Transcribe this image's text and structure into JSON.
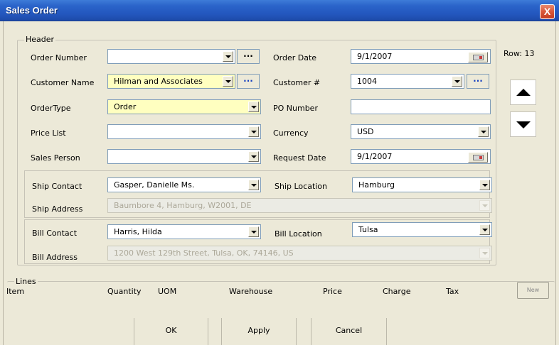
{
  "window": {
    "title": "Sales Order",
    "close_label": "X"
  },
  "header": {
    "legend": "Header",
    "order_number": {
      "label": "Order Number",
      "value": "",
      "button": "..."
    },
    "customer_name": {
      "label": "Customer Name",
      "value": "Hilman and Associates",
      "button": "..."
    },
    "order_type": {
      "label": "OrderType",
      "value": "Order"
    },
    "price_list": {
      "label": "Price List",
      "value": ""
    },
    "sales_person": {
      "label": "Sales Person",
      "value": ""
    },
    "order_date": {
      "label": "Order Date",
      "value": "9/1/2007"
    },
    "customer_num": {
      "label": "Customer #",
      "value": "1004",
      "button": "..."
    },
    "po_number": {
      "label": "PO Number",
      "value": ""
    },
    "currency": {
      "label": "Currency",
      "value": "USD"
    },
    "request_date": {
      "label": "Request Date",
      "value": "9/1/2007"
    },
    "row_indicator": "Row: 13"
  },
  "ship": {
    "contact_label": "Ship Contact",
    "contact_value": "Gasper, Danielle Ms.",
    "location_label": "Ship Location",
    "location_value": "Hamburg",
    "address_label": "Ship Address",
    "address_value": "Baumbore 4, Hamburg, W2001, DE"
  },
  "bill": {
    "contact_label": "Bill Contact",
    "contact_value": "Harris, Hilda",
    "location_label": "Bill Location",
    "location_value": "Tulsa",
    "address_label": "Bill Address",
    "address_value": "1200 West 129th Street, Tulsa, OK, 74146, US"
  },
  "lines": {
    "legend": "Lines",
    "columns": [
      "Item",
      "Quantity",
      "UOM",
      "Warehouse",
      "Price",
      "Charge",
      "Tax"
    ],
    "new_button": "New"
  },
  "footer": {
    "ok": "OK",
    "apply": "Apply",
    "cancel": "Cancel"
  },
  "icons": {
    "nav_up": "arrow-up-icon",
    "nav_down": "arrow-down-icon",
    "calendar": "calendar-icon",
    "dropdown": "chevron-down-icon"
  },
  "colors": {
    "titlebar": "#2356bd",
    "highlight_field": "#ffffc0",
    "ellipsis_blue": "#1740c0"
  }
}
